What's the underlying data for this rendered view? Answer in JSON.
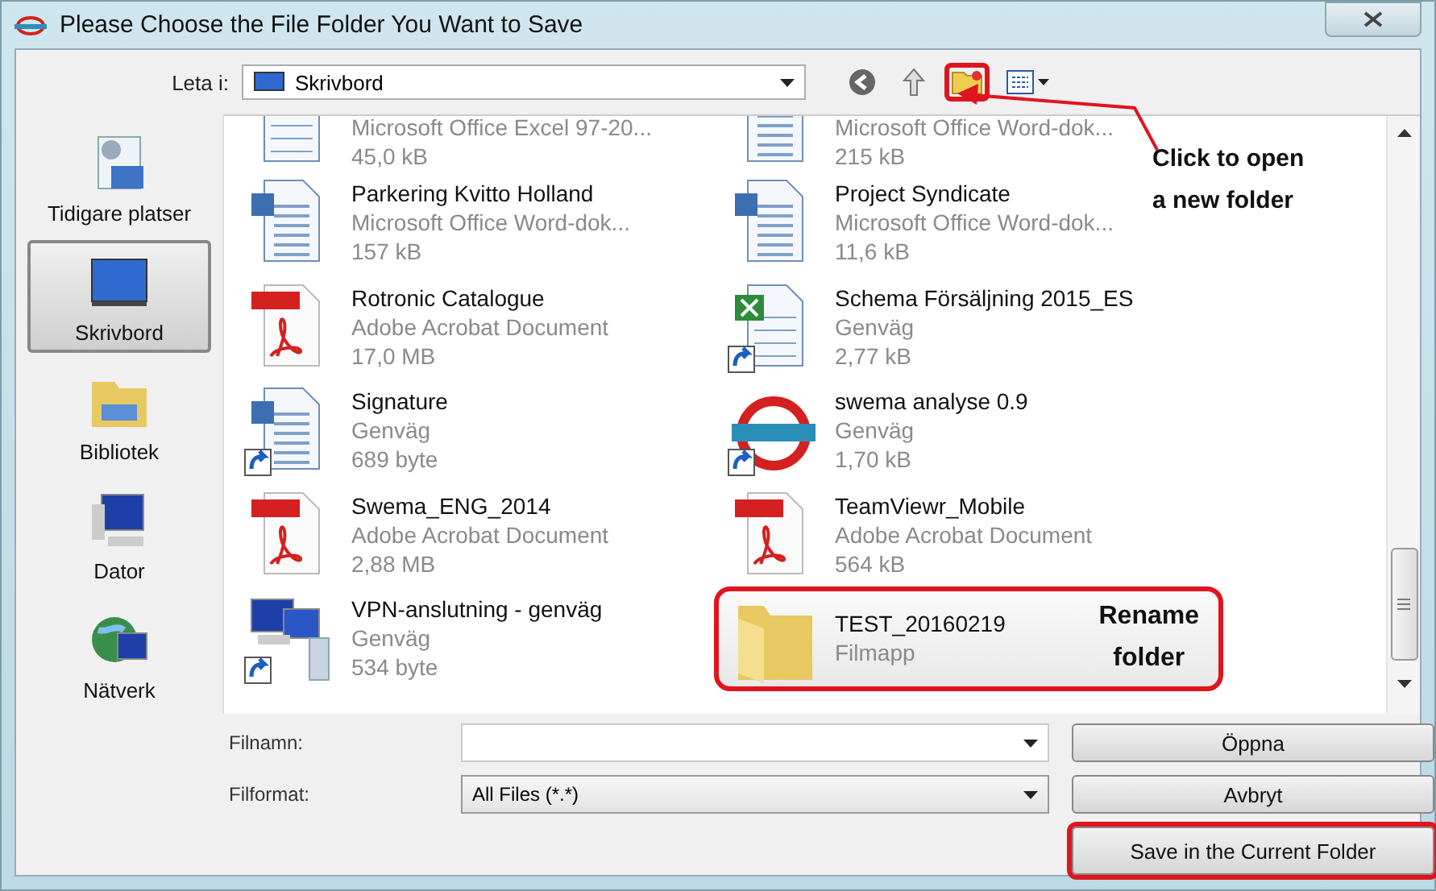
{
  "window": {
    "title": "Please Choose the File Folder You Want to Save"
  },
  "toolbar": {
    "look_in_label": "Leta i:",
    "location": "Skrivbord",
    "new_folder_highlighted": true
  },
  "sidebar": {
    "items": [
      {
        "kind": "recent",
        "label": "Tidigare platser",
        "selected": false
      },
      {
        "kind": "desktop",
        "label": "Skrivbord",
        "selected": true
      },
      {
        "kind": "library",
        "label": "Bibliotek",
        "selected": false
      },
      {
        "kind": "computer",
        "label": "Dator",
        "selected": false
      },
      {
        "kind": "network",
        "label": "Nätverk",
        "selected": false
      }
    ]
  },
  "files": {
    "partial_row": [
      {
        "kind": "excel",
        "shortcut": false,
        "type": "Microsoft Office Excel 97-20...",
        "size": "45,0 kB"
      },
      {
        "kind": "word",
        "shortcut": false,
        "type": "Microsoft Office Word-dok...",
        "size": "215 kB"
      }
    ],
    "items": [
      {
        "kind": "word",
        "shortcut": false,
        "name": "Parkering Kvitto Holland",
        "type": "Microsoft Office Word-dok...",
        "size": "157 kB",
        "highlighted": false
      },
      {
        "kind": "word",
        "shortcut": false,
        "name": "Project Syndicate",
        "type": "Microsoft Office Word-dok...",
        "size": "11,6 kB",
        "highlighted": false
      },
      {
        "kind": "pdf",
        "shortcut": false,
        "name": "Rotronic Catalogue",
        "type": "Adobe Acrobat Document",
        "size": "17,0 MB",
        "highlighted": false
      },
      {
        "kind": "excel",
        "shortcut": true,
        "name": "Schema Försäljning 2015_ES",
        "type": "Genväg",
        "size": "2,77 kB",
        "highlighted": false
      },
      {
        "kind": "word",
        "shortcut": true,
        "name": "Signature",
        "type": "Genväg",
        "size": "689 byte",
        "highlighted": false
      },
      {
        "kind": "logo",
        "shortcut": true,
        "name": "swema analyse 0.9",
        "type": "Genväg",
        "size": "1,70 kB",
        "highlighted": false
      },
      {
        "kind": "pdf",
        "shortcut": false,
        "name": "Swema_ENG_2014",
        "type": "Adobe Acrobat Document",
        "size": "2,88 MB",
        "highlighted": false
      },
      {
        "kind": "pdf",
        "shortcut": false,
        "name": "TeamViewr_Mobile",
        "type": "Adobe Acrobat Document",
        "size": "564 kB",
        "highlighted": false
      },
      {
        "kind": "network",
        "shortcut": true,
        "name": "VPN-anslutning - genväg",
        "type": "Genväg",
        "size": "534 byte",
        "highlighted": false
      },
      {
        "kind": "folder",
        "shortcut": false,
        "name": "TEST_20160219",
        "type": "Filmapp",
        "highlighted": true,
        "note": [
          "Rename",
          "folder"
        ]
      }
    ]
  },
  "annotation": {
    "lines": [
      "Click to open",
      "a new folder"
    ]
  },
  "form": {
    "filename_label": "Filnamn:",
    "format_label": "Filformat:",
    "format_value": "All Files (*.*)"
  },
  "buttons": [
    {
      "label": "Öppna",
      "highlighted": false
    },
    {
      "label": "Avbryt",
      "highlighted": false
    },
    {
      "label": "Save in the Current Folder",
      "highlighted": true
    }
  ]
}
